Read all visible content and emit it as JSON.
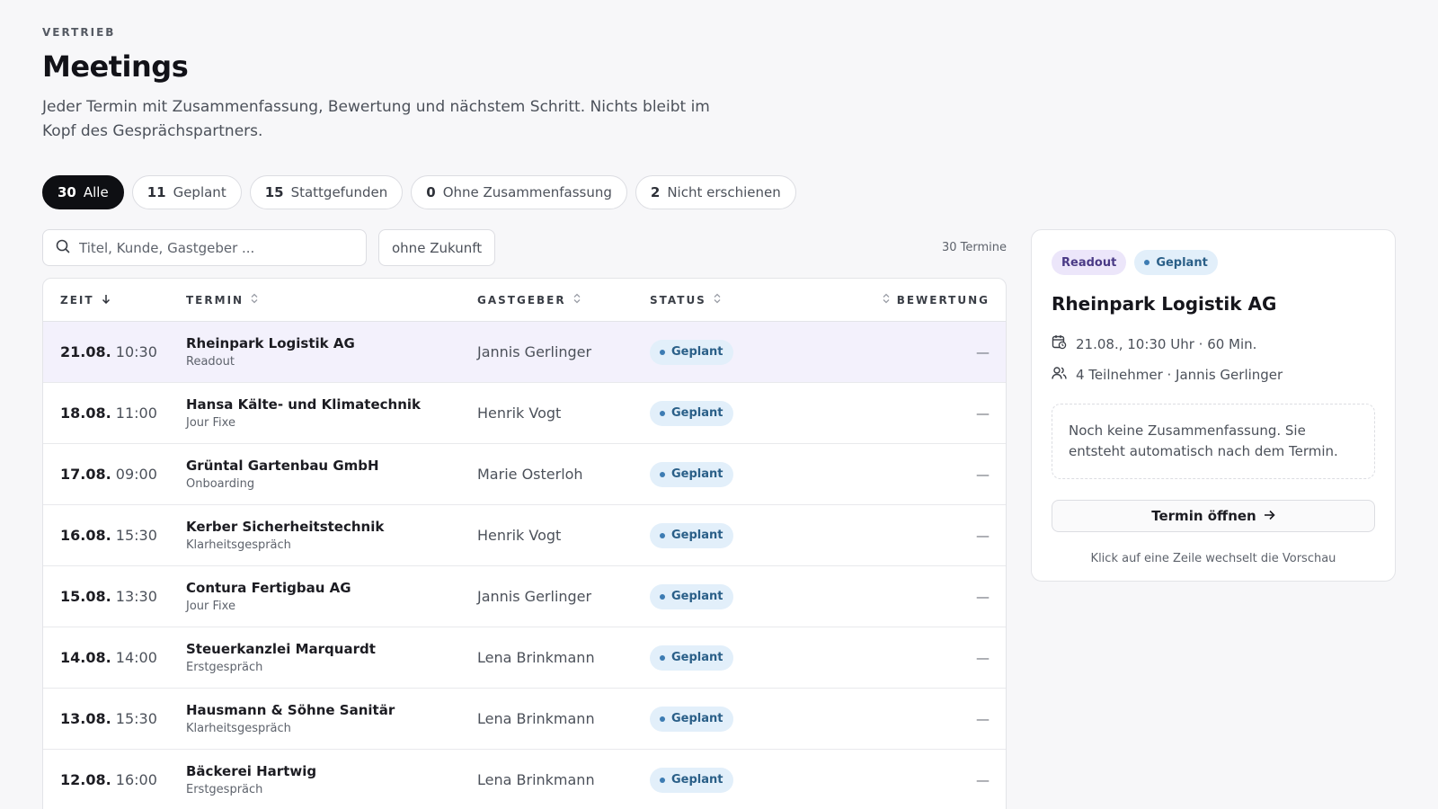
{
  "header": {
    "eyebrow": "VERTRIEB",
    "title": "Meetings",
    "subtitle": "Jeder Termin mit Zusammenfassung, Bewertung und nächstem Schritt. Nichts bleibt im Kopf des Gesprächspartners."
  },
  "filters": [
    {
      "count": "30",
      "label": "Alle",
      "active": true
    },
    {
      "count": "11",
      "label": "Geplant",
      "active": false
    },
    {
      "count": "15",
      "label": "Stattgefunden",
      "active": false
    },
    {
      "count": "0",
      "label": "Ohne Zusammenfassung",
      "active": false
    },
    {
      "count": "2",
      "label": "Nicht erschienen",
      "active": false
    }
  ],
  "toolbar": {
    "search_placeholder": "Titel, Kunde, Gastgeber ...",
    "toggle_label": "ohne Zukunft",
    "count_label": "30 Termine"
  },
  "table": {
    "columns": {
      "zeit": "ZEIT",
      "termin": "TERMIN",
      "gastgeber": "GASTGEBER",
      "status": "STATUS",
      "bewertung": "BEWERTUNG"
    },
    "rows": [
      {
        "date": "21.08.",
        "time": "10:30",
        "title": "Rheinpark Logistik AG",
        "type": "Readout",
        "host": "Jannis Gerlinger",
        "status": "Geplant",
        "rating": "—"
      },
      {
        "date": "18.08.",
        "time": "11:00",
        "title": "Hansa Kälte- und Klimatechnik",
        "type": "Jour Fixe",
        "host": "Henrik Vogt",
        "status": "Geplant",
        "rating": "—"
      },
      {
        "date": "17.08.",
        "time": "09:00",
        "title": "Grüntal Gartenbau GmbH",
        "type": "Onboarding",
        "host": "Marie Osterloh",
        "status": "Geplant",
        "rating": "—"
      },
      {
        "date": "16.08.",
        "time": "15:30",
        "title": "Kerber Sicherheitstechnik",
        "type": "Klarheitsgespräch",
        "host": "Henrik Vogt",
        "status": "Geplant",
        "rating": "—"
      },
      {
        "date": "15.08.",
        "time": "13:30",
        "title": "Contura Fertigbau AG",
        "type": "Jour Fixe",
        "host": "Jannis Gerlinger",
        "status": "Geplant",
        "rating": "—"
      },
      {
        "date": "14.08.",
        "time": "14:00",
        "title": "Steuerkanzlei Marquardt",
        "type": "Erstgespräch",
        "host": "Lena Brinkmann",
        "status": "Geplant",
        "rating": "—"
      },
      {
        "date": "13.08.",
        "time": "15:30",
        "title": "Hausmann & Söhne Sanitär",
        "type": "Klarheitsgespräch",
        "host": "Lena Brinkmann",
        "status": "Geplant",
        "rating": "—"
      },
      {
        "date": "12.08.",
        "time": "16:00",
        "title": "Bäckerei Hartwig",
        "type": "Erstgespräch",
        "host": "Lena Brinkmann",
        "status": "Geplant",
        "rating": "—"
      }
    ]
  },
  "preview": {
    "tag_type": "Readout",
    "tag_status": "Geplant",
    "title": "Rheinpark Logistik AG",
    "datetime": "21.08., 10:30 Uhr · 60 Min.",
    "participants": "4 Teilnehmer · Jannis Gerlinger",
    "summary": "Noch keine Zusammenfassung. Sie entsteht automatisch nach dem Termin.",
    "open_label": "Termin öffnen",
    "hint": "Klick auf eine Zeile wechselt die Vorschau"
  },
  "icons": {
    "search": "search-icon",
    "sort_desc": "arrow-down-icon",
    "sort": "sort-icon",
    "calendar": "calendar-clock-icon",
    "users": "users-icon",
    "arrow_right": "arrow-right-icon"
  },
  "colors": {
    "active_chip": "#0e0f13",
    "status_badge_bg": "#e2effa",
    "status_badge_text": "#2a5f88",
    "readout_tag_bg": "#ece6fa",
    "selected_row": "#f3f1fc"
  }
}
